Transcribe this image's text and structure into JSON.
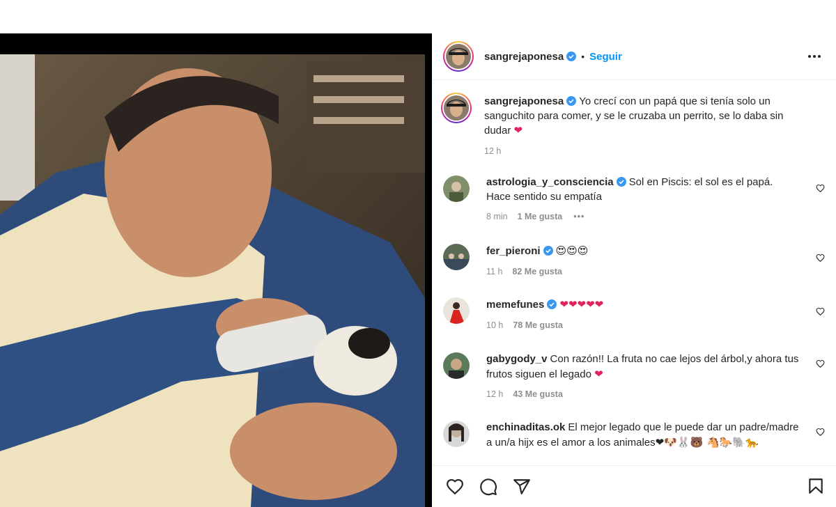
{
  "post": {
    "author": "sangrejaponesa",
    "follow_label": "Seguir",
    "separator": "•",
    "caption": "Yo crecí con un papá que si tenía solo un sanguchito para comer, y se le cruzaba un perrito, se lo daba sin dudar",
    "caption_emoji": "❤",
    "caption_time": "12 h"
  },
  "comments": [
    {
      "user": "astrologia_y_consciencia",
      "verified": true,
      "text": "Sol en Piscis: el sol es el papá. Hace sentido su empatía",
      "emoji": "",
      "time": "8 min",
      "likes": "1 Me gusta",
      "more": "•••"
    },
    {
      "user": "fer_pieroni",
      "verified": true,
      "text": "",
      "emoji": "😍😍😍",
      "time": "11 h",
      "likes": "82 Me gusta",
      "more": ""
    },
    {
      "user": "memefunes",
      "verified": true,
      "text": "",
      "emoji": "❤❤❤❤❤",
      "time": "10 h",
      "likes": "78 Me gusta",
      "more": ""
    },
    {
      "user": "gabygody_v",
      "verified": false,
      "text": "Con razón!! La fruta no cae lejos del árbol,y ahora tus frutos siguen el legado",
      "emoji": "❤",
      "time": "12 h",
      "likes": "43 Me gusta",
      "more": ""
    },
    {
      "user": "enchinaditas.ok",
      "verified": false,
      "text": "El mejor legado que le puede dar un padre/madre a un/a hijx es el amor a los animales",
      "emoji": "❤🐶🐰🐻 🐴🐎🐘🐆",
      "time": "",
      "likes": "",
      "more": ""
    }
  ],
  "icons": {
    "more": "more-options-icon",
    "verified": "verified-badge-icon",
    "like": "heart-icon",
    "comment": "comment-icon",
    "share": "share-icon",
    "save": "bookmark-icon"
  },
  "colors": {
    "accent": "#0095f6",
    "verified": "#3897f0",
    "heart": "#e0245e",
    "meta": "#8e8e8e"
  }
}
